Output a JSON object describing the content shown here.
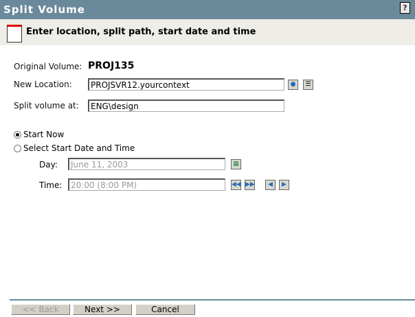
{
  "window": {
    "title": "Split Volume",
    "help": "?"
  },
  "header": {
    "subtitle": "Enter location, split path, start date and time"
  },
  "form": {
    "original_volume_label": "Original Volume:",
    "original_volume_value": "PROJ135",
    "new_location_label": "New Location:",
    "new_location_value": "PROJSVR12.yourcontext",
    "split_at_label": "Split volume at:",
    "split_at_value": "ENG\\design",
    "start_now_label": "Start Now",
    "select_start_label": "Select Start Date and Time",
    "day_label": "Day:",
    "day_value": "June 11, 2003",
    "time_label": "Time:",
    "time_value": "20:00 (8:00 PM)"
  },
  "footer": {
    "back": "<< Back",
    "next": "Next >>",
    "cancel": "Cancel"
  }
}
